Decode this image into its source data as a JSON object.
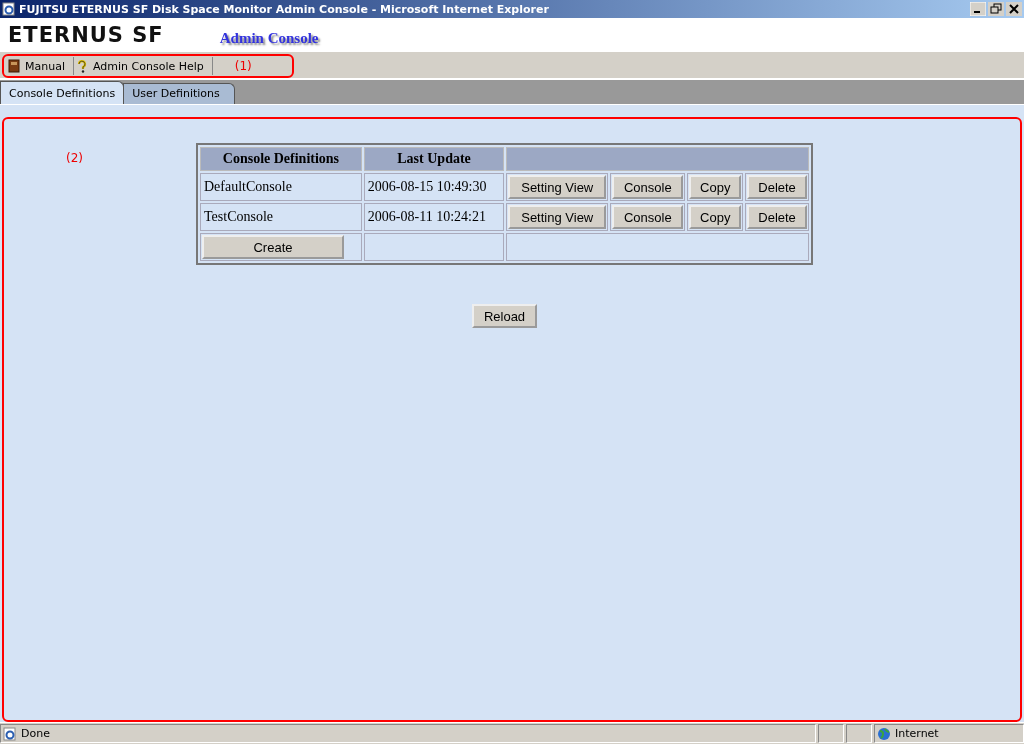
{
  "window": {
    "title": "FUJITSU ETERNUS SF Disk Space Monitor Admin Console - Microsoft Internet Explorer"
  },
  "header": {
    "logo": "ETERNUS SF",
    "subtitle": "Admin Console"
  },
  "toolbar": {
    "items": [
      {
        "label": "Manual",
        "kind": "book"
      },
      {
        "label": "Admin Console Help",
        "kind": "help"
      }
    ],
    "annotation": "(1)"
  },
  "tabs": [
    {
      "label": "Console Definitions",
      "selected": true
    },
    {
      "label": "User Definitions",
      "selected": false
    }
  ],
  "content": {
    "annotation": "(2)",
    "table": {
      "columns": [
        "Console Definitions",
        "Last Update"
      ],
      "rows": [
        {
          "name": "DefaultConsole",
          "updated": "2006-08-15 10:49:30",
          "actions": [
            "Setting View",
            "Console",
            "Copy",
            "Delete"
          ]
        },
        {
          "name": "TestConsole",
          "updated": "2006-08-11 10:24:21",
          "actions": [
            "Setting View",
            "Console",
            "Copy",
            "Delete"
          ]
        }
      ],
      "create_button": "Create"
    },
    "reload_button": "Reload"
  },
  "status_bar": {
    "status": "Done",
    "zone": "Internet"
  }
}
